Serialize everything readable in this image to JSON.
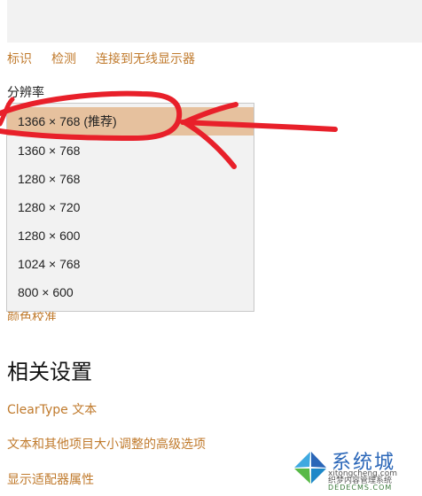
{
  "top_links": [
    "标识",
    "检测",
    "连接到无线显示器"
  ],
  "resolution_label": "分辨率",
  "resolution_options": [
    {
      "label": "1366 × 768 (推荐)",
      "selected": true
    },
    {
      "label": "1360 × 768",
      "selected": false
    },
    {
      "label": "1280 × 768",
      "selected": false
    },
    {
      "label": "1280 × 720",
      "selected": false
    },
    {
      "label": "1280 × 600",
      "selected": false
    },
    {
      "label": "1024 × 768",
      "selected": false
    },
    {
      "label": "800 × 600",
      "selected": false
    }
  ],
  "partially_hidden_link": "颜色校准",
  "related_settings": {
    "title": "相关设置",
    "links": [
      "ClearType 文本",
      "文本和其他项目大小调整的高级选项",
      "显示适配器属性"
    ]
  },
  "colors": {
    "accent": "#c07a2c",
    "selected_bg": "#e6c19e",
    "annotation": "#e8202a"
  },
  "watermark": {
    "logo_text": "系统城",
    "site": "xitongcheng.com",
    "badge": "织梦内容管理系统",
    "badge_site": "DEDECMS.COM"
  }
}
